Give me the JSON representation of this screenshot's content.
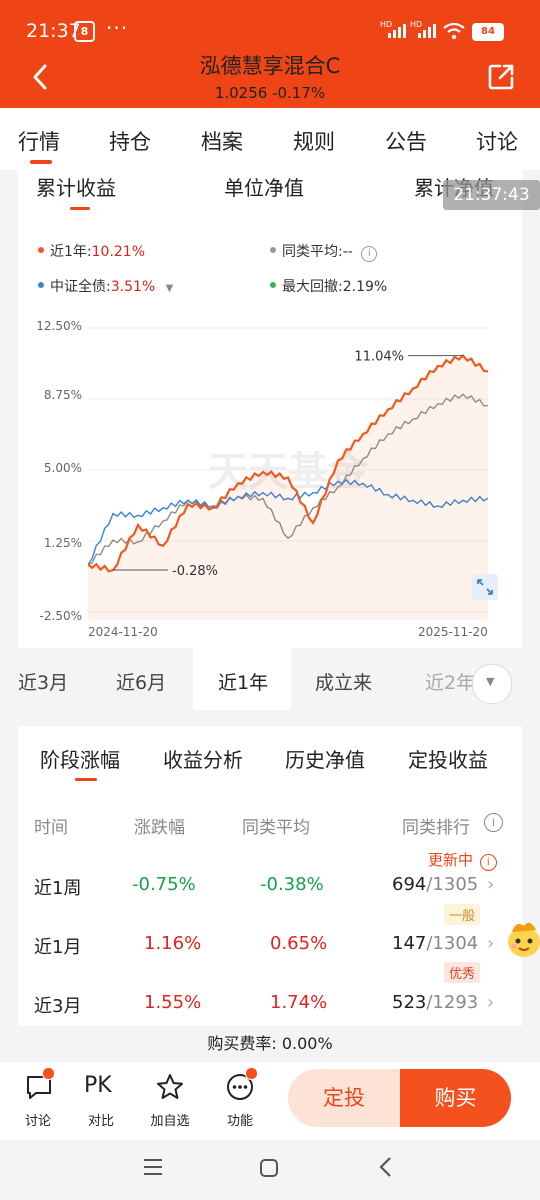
{
  "status": {
    "time": "21:37",
    "dots": "···",
    "battery": "84",
    "net1": "HD",
    "net2": "HD"
  },
  "header": {
    "title": "泓德慧享混合C",
    "subtitle": "1.0256  -0.17%"
  },
  "tabs": [
    "行情",
    "持仓",
    "档案",
    "规则",
    "公告",
    "讨论"
  ],
  "chart_tabs": [
    "累计收益",
    "单位净值",
    "累计净值"
  ],
  "timestamp_overlay": "21:37:43",
  "legend": {
    "fund_label": "近1年:",
    "fund_value": "10.21%",
    "peer_label": "同类平均:",
    "peer_value": "--",
    "index_label": "中证全债:",
    "index_value": "3.51%",
    "drawdown_label": "最大回撤:",
    "drawdown_value": "2.19%"
  },
  "watermark": "天天基金",
  "chart_data": {
    "type": "line",
    "x": [
      "2024-11-20",
      "2025-11-20"
    ],
    "y_ticks": [
      "12.50%",
      "8.75%",
      "5.00%",
      "1.25%",
      "-2.50%"
    ],
    "ylim": [
      -2.5,
      12.5
    ],
    "annotations": {
      "max": "11.04%",
      "min": "-0.28%"
    },
    "series": [
      {
        "name": "近1年",
        "color": "#ef5a1e",
        "values": [
          0,
          -0.28,
          2.1,
          1.0,
          3.2,
          3.0,
          4.3,
          4.9,
          4.6,
          2.2,
          5.5,
          6.9,
          8.2,
          9.3,
          10.5,
          11.04,
          10.21
        ]
      },
      {
        "name": "同类平均",
        "color": "#8e8e8e",
        "values": [
          0,
          1.3,
          1.2,
          2.3,
          3.4,
          3.0,
          3.6,
          3.5,
          1.4,
          3.0,
          4.1,
          5.6,
          6.9,
          7.7,
          8.5,
          9.0,
          8.4
        ]
      },
      {
        "name": "中证全债",
        "color": "#3b82d6",
        "values": [
          0,
          2.7,
          2.6,
          3.0,
          3.4,
          3.1,
          3.6,
          3.8,
          3.5,
          3.8,
          4.4,
          4.3,
          3.7,
          3.4,
          3.1,
          3.4,
          3.51
        ]
      }
    ]
  },
  "periods": [
    "近3月",
    "近6月",
    "近1年",
    "成立来",
    "近2年"
  ],
  "stage_tabs": [
    "阶段涨幅",
    "收益分析",
    "历史净值",
    "定投收益"
  ],
  "table": {
    "headers": [
      "时间",
      "涨跌幅",
      "同类平均",
      "同类排行"
    ],
    "updating": "更新中",
    "rows": [
      {
        "period": "近1周",
        "change": "-0.75%",
        "avg": "-0.38%",
        "rank": "694",
        "total": "/1305",
        "tag": "一般"
      },
      {
        "period": "近1月",
        "change": "1.16%",
        "avg": "0.65%",
        "rank": "147",
        "total": "/1304",
        "tag": "优秀"
      },
      {
        "period": "近3月",
        "change": "1.55%",
        "avg": "1.74%",
        "rank": "523",
        "total": "/1293",
        "tag": ""
      }
    ]
  },
  "fee": "购买费率: 0.00%",
  "bottom": {
    "items": [
      "讨论",
      "对比",
      "加自选",
      "功能"
    ],
    "pk": "PK",
    "dingtou": "定投",
    "buy": "购买"
  }
}
